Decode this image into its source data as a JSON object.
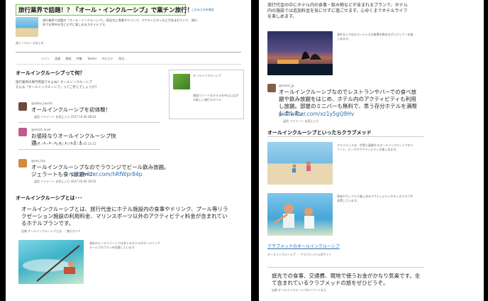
{
  "left": {
    "header_title": "旅行業界で話題！？『オール・インクルーシブ』で業チン旅行！",
    "header_link": "このまとめを報告",
    "intro_caption": "旅行業界で話題の「オール・インクルーシブ」。宿泊代に食事やドリンク、アクティビティなどが含まれていて、旅行先でお財布を気にせずに楽しめるスタイルです。",
    "user_label": "旅人 / クルーズまとめ",
    "nav": [
      "ツイン",
      "画像",
      "動画",
      "特集",
      "Twitter",
      "中止カテ",
      "宿泊..."
    ],
    "section1_title": "オールインクルーシブって何？",
    "section1_caption": "旅行業界の専門用語ですよね？オールインクルーシブ\nそんな「オールインクルーシブ」ってご存じでしょうか？",
    "sidebar_card_title": "オールインクルーシブ",
    "sidebar_card_text": "南国リゾートのホテルを中心に広がる新しい旅行スタイル",
    "tweets": [
      {
        "user": "@aloha_tourist",
        "text": "オールインクルーシブを初体験！",
        "meta": "返信  リツイート  お気に入り  2017.10.06 08:42"
      },
      {
        "user": "@resort_lover",
        "text": "お値段なりオールインクルーシブ快適・・・・・・・！！",
        "meta": "返信  リツイート  お気に入り  2017.10.05 21:15"
      },
      {
        "user": "@sea_trip",
        "text": "オールインクルーシブなのでラウンジでビール飲み放題。ジェラートも食べ放題〜♪",
        "link": "pic.twitter.com/hRfWpr84p",
        "meta": "返信  リツイート  お気に入り  2017.10.04 19:03"
      }
    ],
    "section2_title": "オールインクルーシブとは･･･",
    "section2_text": "オールインクルーシブとは、旅行代金にホテル施設内の食事やドリンク、プール等リラクゼーション施設の利用料金、マリンスポーツ以外のアクティビティ料金が含まれているホテルプランです。",
    "section2_source": "出典  オールインクルーシブとは ｜ 旅行ガイド",
    "image_caption": "海外のビーチリゾートでは多くのホテルがオールインクルーシブのプランを用意しています"
  },
  "right": {
    "top_text": "旅行代金の中にホテル内の食事・飲み物などが含まれるプランで、ホテル内の施設では追加料金を気にせずに過ごせます。心ゆくまでホテルライフを楽しめます。",
    "photo1_caption": "海外ならではのゴージャスな夜景を眺めながらディナーを楽しめます。",
    "tweet_user": "@travel_jp",
    "tweet_text": "オールインクルーシブなのでレストランやバーでの食べ放題や飲み放題をはじめ、ホテル内のアクティビティも利用し放題。部屋のミニバーも無料で、思う存分ホテルを満喫しました。",
    "tweet_link": "pic.twitter.com/xz1y5gQ9Hv",
    "tweet_meta": "返信  リツイート  お気に入り",
    "section_title": "オールインクルーシブといったらクラブメッド",
    "photo2_caption": "クラブメッドは、世界に展開するオールインクルーシブのリゾート。ビーチやアクティビティが楽しめます。",
    "photo3_caption": "家族やカップルで楽しめるアクティビティやキッズクラブが充実しています。",
    "club_link": "クラブメッドのオールインクルーシブ",
    "club_link_desc": "オールインクルーシブ ｜ クラブメッド公式サイト",
    "bottom_text": "旅先での食事、交通費、現地で使うお金がかなり気楽です。全て含まれているクラブメッドの旅をぜひどうぞ。",
    "bottom_source": "出典  オールインクルーシブのリゾートなら"
  },
  "colors": {
    "header_border": "#7fbf5a",
    "link": "#2a6db0",
    "background": "#000000"
  }
}
